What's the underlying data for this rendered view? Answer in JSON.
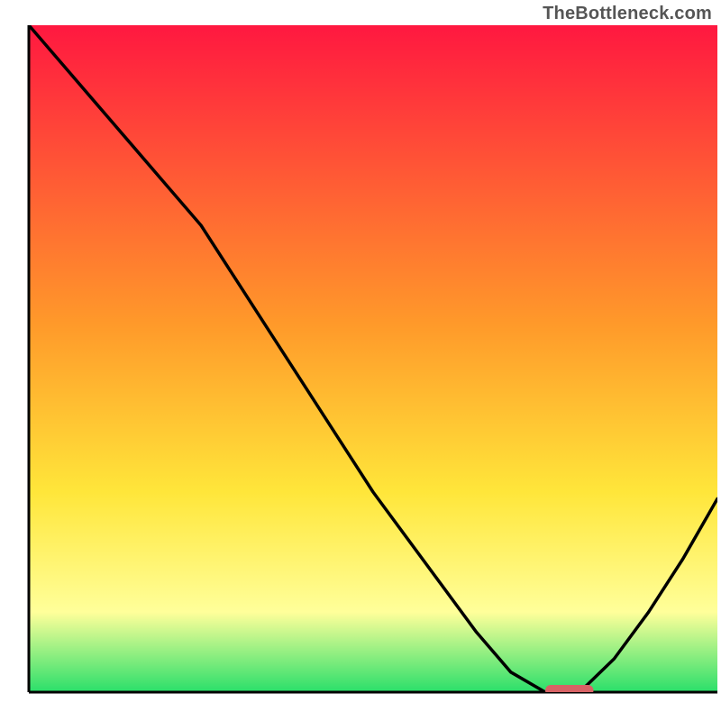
{
  "watermark": "TheBottleneck.com",
  "colors": {
    "red": "#ff1840",
    "orange": "#ff9a2a",
    "yellow": "#ffe63a",
    "paleyellow": "#ffff9a",
    "green": "#2adf6a",
    "axis": "#000000",
    "curve": "#000000",
    "marker": "#d86265"
  },
  "chart_data": {
    "type": "line",
    "title": "",
    "xlabel": "",
    "ylabel": "",
    "xlim": [
      0,
      100
    ],
    "ylim": [
      0,
      100
    ],
    "x": [
      0,
      5,
      10,
      15,
      20,
      25,
      30,
      35,
      40,
      45,
      50,
      55,
      60,
      65,
      70,
      75,
      80,
      85,
      90,
      95,
      100
    ],
    "values": [
      100,
      94,
      88,
      82,
      76,
      70,
      62,
      54,
      46,
      38,
      30,
      23,
      16,
      9,
      3,
      0,
      0,
      5,
      12,
      20,
      29
    ],
    "marker": {
      "x_start": 75,
      "x_end": 82,
      "y": 0
    }
  }
}
